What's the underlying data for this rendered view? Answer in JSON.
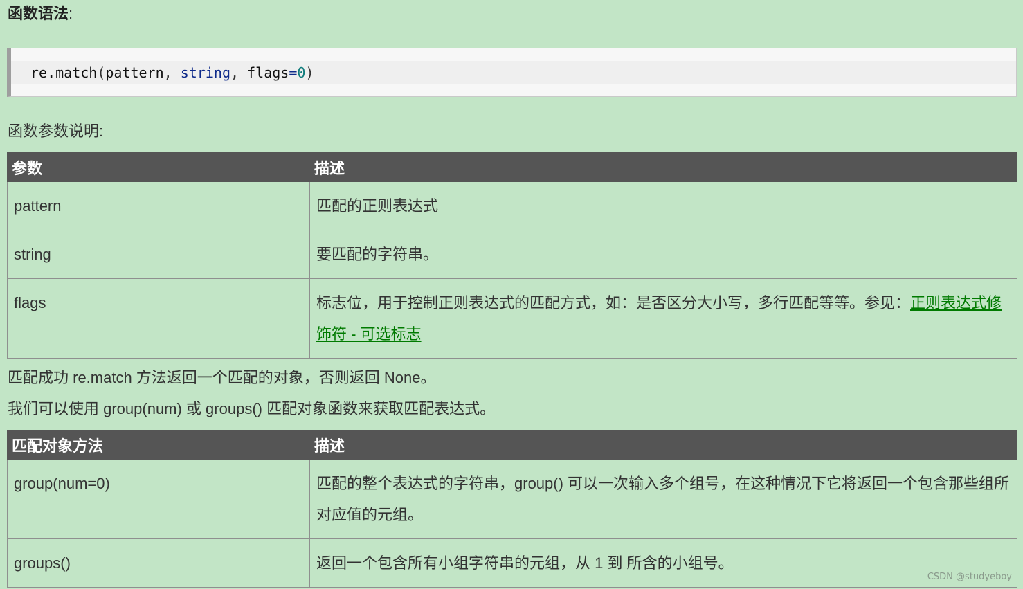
{
  "heading": {
    "label": "函数语法",
    "colon": ":"
  },
  "code": {
    "fn": "re.match",
    "open": "(",
    "arg1": "pattern",
    "sep1": ", ",
    "arg2": "string",
    "sep2": ", ",
    "arg3": "flags",
    "eq": "=",
    "default": "0",
    "close": ")"
  },
  "params_intro": "函数参数说明:",
  "param_table": {
    "headers": [
      "参数",
      "描述"
    ],
    "rows": [
      {
        "name": "pattern",
        "desc": "匹配的正则表达式"
      },
      {
        "name": "string",
        "desc": "要匹配的字符串。"
      },
      {
        "name": "flags",
        "desc": "标志位，用于控制正则表达式的匹配方式，如：是否区分大小写，多行匹配等等。参见：",
        "link": "正则表达式修饰符 - 可选标志"
      }
    ]
  },
  "return_text": "匹配成功 re.match 方法返回一个匹配的对象，否则返回 None。",
  "group_text": "我们可以使用 group(num) 或 groups() 匹配对象函数来获取匹配表达式。",
  "method_table": {
    "headers": [
      "匹配对象方法",
      "描述"
    ],
    "rows": [
      {
        "name": "group(num=0)",
        "desc": "匹配的整个表达式的字符串，group() 可以一次输入多个组号，在这种情况下它将返回一个包含那些组所对应值的元组。"
      },
      {
        "name": "groups()",
        "desc": "返回一个包含所有小组字符串的元组，从 1 到 所含的小组号。"
      }
    ]
  },
  "watermark": "CSDN @studyeboy"
}
